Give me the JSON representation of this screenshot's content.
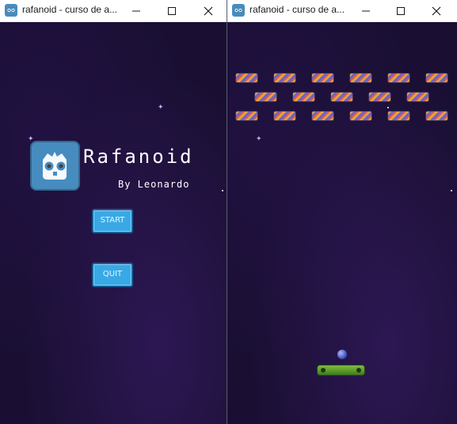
{
  "left_window": {
    "title": "rafanoid - curso de a...",
    "game": {
      "title": "Rafanoid",
      "byline": "By Leonardo",
      "start_label": "START",
      "quit_label": "QUIT"
    }
  },
  "right_window": {
    "title": "rafanoid - curso de a..."
  },
  "colors": {
    "background": "#1a0f33",
    "button": "#39a9e6",
    "godot_blue": "#478cbf",
    "paddle": "#5f9e2a",
    "ball": "#4a5bd0"
  },
  "icons": [
    "godot-app-icon",
    "minimize-icon",
    "maximize-icon",
    "close-icon",
    "godot-logo",
    "star-icon"
  ]
}
